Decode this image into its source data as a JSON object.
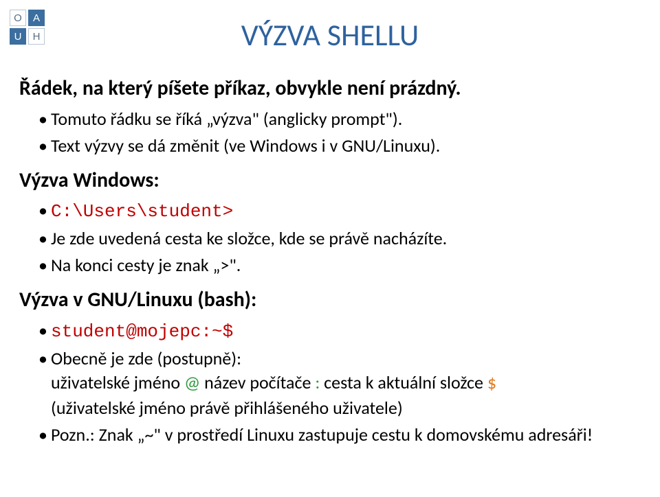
{
  "logo": {
    "o": "O",
    "a": "A",
    "u": "U",
    "h": "H"
  },
  "title": "VÝZVA SHELLU",
  "s1": {
    "head": "Řádek, na který píšete příkaz, obvykle není prázdný.",
    "b1": "Tomuto řádku se říká „výzva\" (anglicky prompt\").",
    "b2": "Text výzvy se dá změnit (ve Windows i v GNU/Linuxu)."
  },
  "s2": {
    "head": "Výzva Windows:",
    "prompt": "C:\\Users\\student>",
    "b2": "Je zde uvedená cesta ke složce, kde se právě nacházíte.",
    "b3": "Na konci cesty je znak „>\"."
  },
  "s3": {
    "head": "Výzva v GNU/Linuxu (bash):",
    "prompt": "student@mojepc:~$",
    "b2": "Obecně je zde (postupně):",
    "sub1a": "uživatelské jméno ",
    "sub1_at": "@",
    "sub1b": " název počítače ",
    "sub1_colon": ":",
    "sub1c": " cesta k aktuální složce ",
    "sub1_dollar": "$",
    "sub2": "(uživatelské jméno právě přihlášeného uživatele)",
    "b3": "Pozn.: Znak „~\" v prostředí Linuxu zastupuje cestu k domovskému adresáři!"
  }
}
